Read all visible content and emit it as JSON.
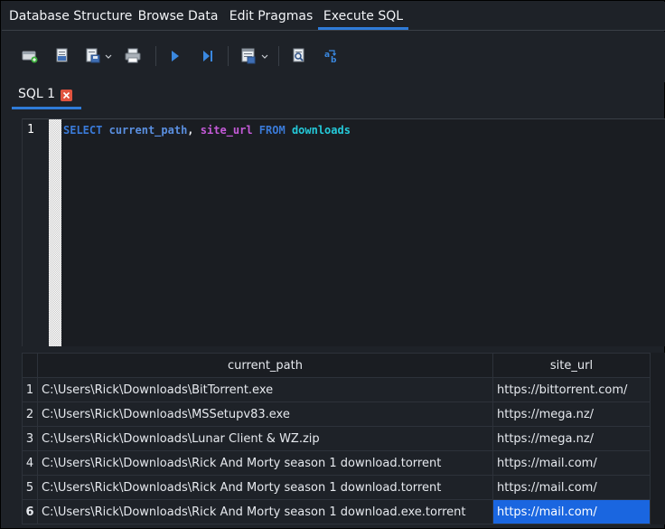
{
  "main_tabs": [
    {
      "label": "Database Structure",
      "active": false
    },
    {
      "label": "Browse Data",
      "active": false
    },
    {
      "label": "Edit Pragmas",
      "active": false
    },
    {
      "label": "Execute SQL",
      "active": true
    }
  ],
  "toolbar": {
    "icons": [
      "open-tab-icon",
      "open-sql-file-icon",
      "save-sql-file-icon",
      "print-icon",
      "execute-all-icon",
      "execute-line-icon",
      "save-results-icon",
      "find-icon",
      "find-replace-icon"
    ]
  },
  "sql_tab": {
    "label": "SQL 1",
    "close_icon": "close-icon"
  },
  "editor": {
    "line_number": "1",
    "tokens": {
      "select": "SELECT",
      "col1": "current_path",
      "comma": ",",
      "col2": "site_url",
      "from": "FROM",
      "table": "downloads"
    }
  },
  "results": {
    "columns": [
      "current_path",
      "site_url"
    ],
    "rows": [
      {
        "n": "1",
        "current_path": "C:\\Users\\Rick\\Downloads\\BitTorrent.exe",
        "site_url": "https://bittorrent.com/"
      },
      {
        "n": "2",
        "current_path": "C:\\Users\\Rick\\Downloads\\MSSetupv83.exe",
        "site_url": "https://mega.nz/"
      },
      {
        "n": "3",
        "current_path": "C:\\Users\\Rick\\Downloads\\Lunar Client & WZ.zip",
        "site_url": "https://mega.nz/"
      },
      {
        "n": "4",
        "current_path": "C:\\Users\\Rick\\Downloads\\Rick And Morty season 1 download.torrent",
        "site_url": "https://mail.com/"
      },
      {
        "n": "5",
        "current_path": "C:\\Users\\Rick\\Downloads\\Rick And Morty season 1 download.torrent",
        "site_url": "https://mail.com/"
      },
      {
        "n": "6",
        "current_path": "C:\\Users\\Rick\\Downloads\\Rick And Morty season 1 download.exe.torrent",
        "site_url": "https://mail.com/"
      }
    ],
    "selected_row": 6,
    "selected_column": "site_url"
  },
  "colors": {
    "accent": "#2f7bd8",
    "selection": "#1a66e0",
    "background": "#1e2228"
  }
}
